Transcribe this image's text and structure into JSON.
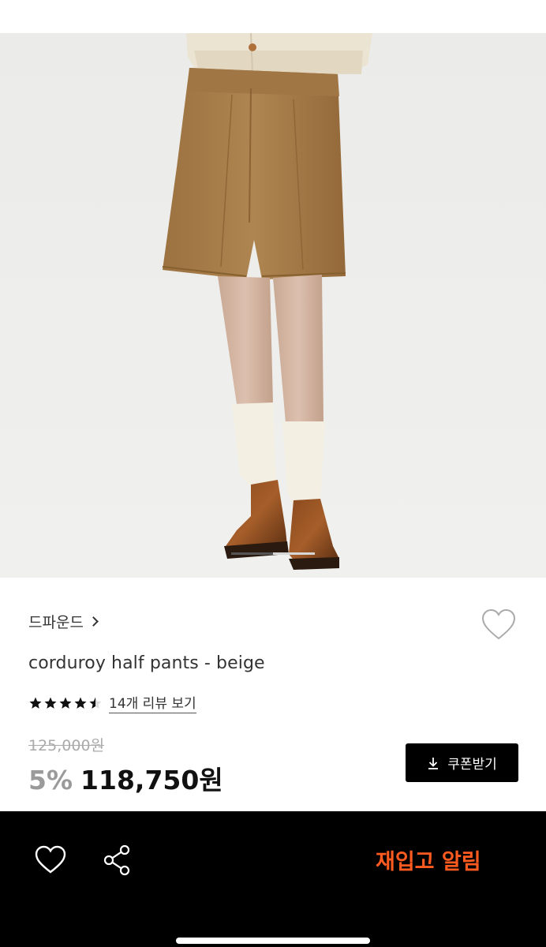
{
  "product": {
    "brand": "드파운드",
    "title": "corduroy half pants - beige",
    "rating": 4.5,
    "review_link": "14개 리뷰 보기",
    "original_price": "125,000원",
    "discount": "5%",
    "price": "118,750원",
    "coupon_label": "쿠폰받기"
  },
  "bottom_bar": {
    "restock_label": "재입고 알림"
  },
  "colors": {
    "accent": "#ff5a1f",
    "bar": "#000000",
    "shorts": "#a57b45"
  },
  "icons": [
    "heart-icon",
    "share-icon",
    "download-icon",
    "chevron-right-icon",
    "star-icon"
  ]
}
